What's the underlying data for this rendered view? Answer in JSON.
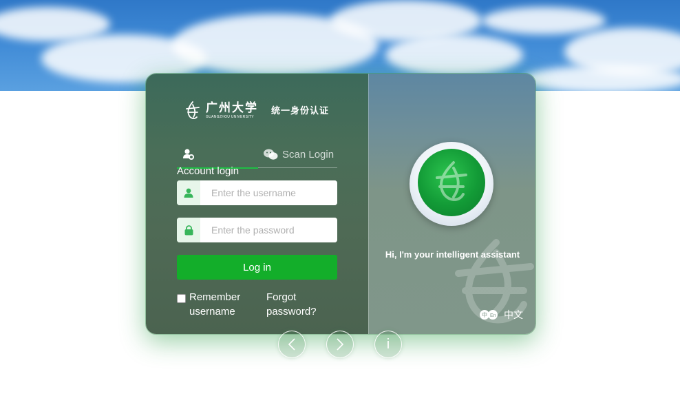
{
  "header": {
    "university_name_cn": "广州大学",
    "university_name_en": "GUANGZHOU UNIVERSITY",
    "system_title": "统一身份认证"
  },
  "tabs": {
    "account_icon": "user-shield-icon",
    "scan_label": "Scan Login",
    "scan_icon": "wechat-icon"
  },
  "login_form": {
    "section_label": "Account login",
    "username_placeholder": "Enter the username",
    "password_placeholder": "Enter the password",
    "username_icon": "user-icon",
    "password_icon": "lock-icon",
    "login_button": "Log in",
    "remember_label": "Remember username",
    "forgot_label": "Forgot password?"
  },
  "assistant": {
    "greeting": "Hi, I'm your intelligent assistant"
  },
  "language": {
    "label": "中文",
    "icon": "language-switch-icon"
  },
  "carousel": {
    "prev_icon": "chevron-left-icon",
    "next_icon": "chevron-right-icon",
    "info_label": "i"
  },
  "colors": {
    "accent": "#13ae2a",
    "tab_active": "#1fbf45",
    "field_prefix_bg": "#e7f6ea"
  }
}
